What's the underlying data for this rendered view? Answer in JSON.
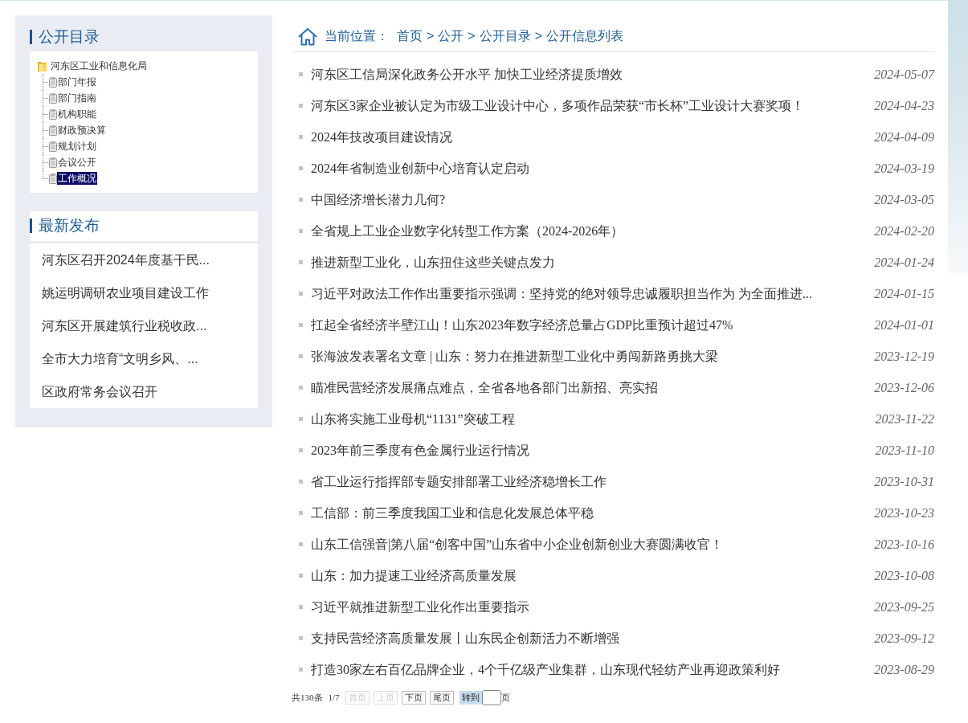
{
  "sidebar": {
    "catalog": {
      "title": "公开目录",
      "tree": {
        "label": "河东区工业和信息化局",
        "children": [
          {
            "label": "部门年报",
            "selected": false
          },
          {
            "label": "部门指南",
            "selected": false
          },
          {
            "label": "机构职能",
            "selected": false
          },
          {
            "label": "财政预决算",
            "selected": false
          },
          {
            "label": "规划计划",
            "selected": false
          },
          {
            "label": "会议公开",
            "selected": false
          },
          {
            "label": "工作概况",
            "selected": true
          }
        ]
      }
    },
    "latest": {
      "title": "最新发布",
      "items": [
        "河东区召开2024年度基干民...",
        "姚运明调研农业项目建设工作",
        "河东区开展建筑行业税收政...",
        "全市大力培育“文明乡风、...",
        "区政府常务会议召开"
      ]
    }
  },
  "breadcrumb": {
    "label": "当前位置：",
    "crumbs": [
      {
        "label": "首页",
        "separator": ">"
      },
      {
        "label": "公开",
        "separator": ">"
      },
      {
        "label": "公开目录",
        "separator": ">"
      },
      {
        "label": "公开信息列表"
      }
    ]
  },
  "articles": [
    {
      "title": "河东区工信局深化政务公开水平 加快工业经济提质增效",
      "date": "2024-05-07"
    },
    {
      "title": "河东区3家企业被认定为市级工业设计中心，多项作品荣获“市长杯”工业设计大赛奖项！",
      "date": "2024-04-23"
    },
    {
      "title": "2024年技改项目建设情况",
      "date": "2024-04-09"
    },
    {
      "title": "2024年省制造业创新中心培育认定启动",
      "date": "2024-03-19"
    },
    {
      "title": "中国经济增长潜力几何?",
      "date": "2024-03-05"
    },
    {
      "title": "全省规上工业企业数字化转型工作方案（2024-2026年）",
      "date": "2024-02-20"
    },
    {
      "title": "推进新型工业化，山东扭住这些关键点发力",
      "date": "2024-01-24"
    },
    {
      "title": "习近平对政法工作作出重要指示强调：坚持党的绝对领导忠诚履职担当作为 为全面推进...",
      "date": "2024-01-15"
    },
    {
      "title": "扛起全省经济半壁江山！山东2023年数字经济总量占GDP比重预计超过47%",
      "date": "2024-01-01"
    },
    {
      "title": "张海波发表署名文章 | 山东：努力在推进新型工业化中勇闯新路勇挑大梁",
      "date": "2023-12-19"
    },
    {
      "title": "瞄准民营经济发展痛点难点，全省各地各部门出新招、亮实招",
      "date": "2023-12-06"
    },
    {
      "title": "山东将实施工业母机“1131”突破工程",
      "date": "2023-11-22"
    },
    {
      "title": "2023年前三季度有色金属行业运行情况",
      "date": "2023-11-10"
    },
    {
      "title": "省工业运行指挥部专题安排部署工业经济稳增长工作",
      "date": "2023-10-31"
    },
    {
      "title": "工信部：前三季度我国工业和信息化发展总体平稳",
      "date": "2023-10-23"
    },
    {
      "title": "山东工信强音|第八届“创客中国”山东省中小企业创新创业大赛圆满收官！",
      "date": "2023-10-16"
    },
    {
      "title": "山东：加力提速工业经济高质量发展",
      "date": "2023-10-08"
    },
    {
      "title": "习近平就推进新型工业化作出重要指示",
      "date": "2023-09-25"
    },
    {
      "title": "支持民营经济高质量发展丨山东民企创新活力不断增强",
      "date": "2023-09-12"
    },
    {
      "title": "打造30家左右百亿品牌企业，4个千亿级产业集群，山东现代轻纺产业再迎政策利好",
      "date": "2023-08-29"
    }
  ],
  "pagination": {
    "total": "共130条",
    "page": "1/7",
    "buttons": [
      {
        "label": "首页",
        "disabled": true
      },
      {
        "label": "上页",
        "disabled": true
      },
      {
        "label": "下页",
        "disabled": false
      },
      {
        "label": "尾页",
        "disabled": false
      }
    ],
    "goto_button": "转到",
    "suffix": "页"
  }
}
